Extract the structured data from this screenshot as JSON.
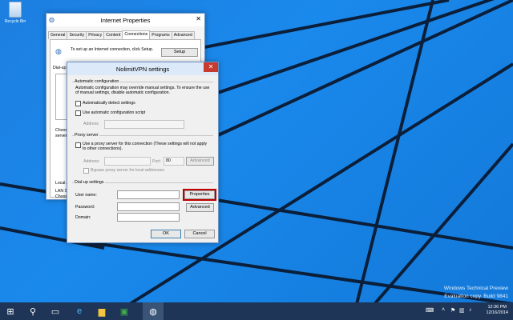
{
  "desktop": {
    "recycle_bin_label": "Recycle Bin",
    "watermark_line1": "Windows Technical Preview",
    "watermark_line2": "Evaluation copy. Build 9841"
  },
  "ie_window": {
    "title": "Internet Properties",
    "tabs": [
      "General",
      "Security",
      "Privacy",
      "Content",
      "Connections",
      "Programs",
      "Advanced"
    ],
    "selected_tab": "Connections",
    "setup_text": "To set up an Internet connection, click Setup.",
    "setup_button": "Setup",
    "dialup_label": "Dial-up",
    "choose_text_1": "Choose",
    "choose_text_2": "server",
    "local_area_label": "Local A",
    "lan_text_1": "LAN S",
    "lan_text_2": "Choos"
  },
  "vpn_dialog": {
    "title": "NolimitVPN settings",
    "auto_config": {
      "group_label": "Automatic configuration",
      "description": "Automatic configuration may override manual settings. To ensure the use of manual settings, disable automatic configuration.",
      "detect_label": "Automatically detect settings",
      "script_label": "Use automatic configuration script",
      "address_label": "Address"
    },
    "proxy": {
      "group_label": "Proxy server",
      "use_proxy_label": "Use a proxy server for this connection (These settings will not apply to other connections).",
      "address_label": "Address:",
      "port_label": "Port:",
      "port_value": "80",
      "advanced_button": "Advanced",
      "bypass_label": "Bypass proxy server for local addresses"
    },
    "dialup": {
      "group_label": "Dial-up settings",
      "username_label": "User name:",
      "password_label": "Password:",
      "domain_label": "Domain:",
      "properties_button": "Properties",
      "advanced_button": "Advanced"
    },
    "ok_button": "OK",
    "cancel_button": "Cancel"
  },
  "taskbar": {
    "time": "12:36 PM",
    "date": "12/16/2014"
  },
  "colors": {
    "desktop_blue": "#1a89ec",
    "taskbar": "#1e3557",
    "close_red": "#c73a2e",
    "highlight": "#c00000"
  }
}
